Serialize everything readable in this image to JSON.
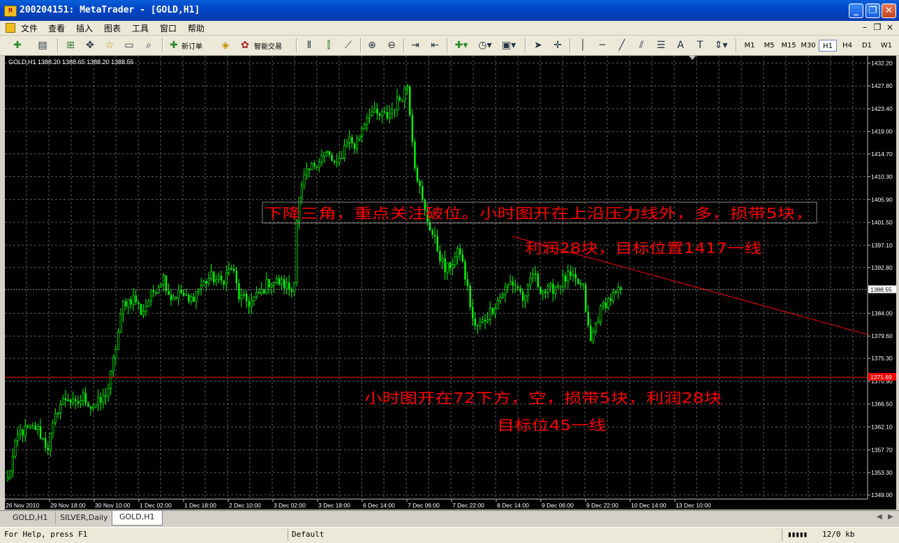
{
  "window": {
    "title": "200204151: MetaTrader - [GOLD,H1]",
    "app_icon": "metatrader-logo-icon",
    "min_glyph": "_",
    "max_glyph": "❐",
    "close_glyph": "✕"
  },
  "menu": {
    "items": [
      "文件",
      "查看",
      "插入",
      "图表",
      "工具",
      "窗口",
      "帮助"
    ],
    "mdi": {
      "min": "–",
      "restore": "❐",
      "close": "×"
    }
  },
  "toolbar": {
    "new_order_label": "新订单",
    "expert_label": "智能交易",
    "timeframes": [
      "M1",
      "M5",
      "M15",
      "M30",
      "H1",
      "H4",
      "D1",
      "W1"
    ],
    "active_timeframe": "H1",
    "text_tool_label": "A"
  },
  "chart": {
    "header": "GOLD,H1  1388.20 1388.65 1388.20 1388.55",
    "annotation_1": "下降三角，重点关注破位。小时图开在上沿压力线外，多，损带5块，",
    "annotation_2": "利润28块，目标位置1417一线",
    "annotation_3": "小时图开在72下方，空，损带5块，利润28块",
    "annotation_4": "目标位45一线",
    "current_price_label": "1388.55",
    "support_price_label": "1371.69"
  },
  "chart_data": {
    "type": "candlestick",
    "symbol": "GOLD",
    "timeframe": "H1",
    "ylim": [
      1348.2,
      1433.6
    ],
    "y_ticks": [
      "1432.20",
      "1427.80",
      "1423.40",
      "1419.00",
      "1414.70",
      "1410.30",
      "1405.90",
      "1401.50",
      "1397.10",
      "1392.80",
      "1388.55",
      "1384.00",
      "1379.60",
      "1375.30",
      "1370.90",
      "1366.50",
      "1362.10",
      "1357.70",
      "1353.30",
      "1349.00"
    ],
    "y_tick_values": [
      1432.2,
      1427.8,
      1423.4,
      1419.0,
      1414.7,
      1410.3,
      1405.9,
      1401.5,
      1397.1,
      1392.8,
      1388.55,
      1384.0,
      1379.6,
      1375.3,
      1370.9,
      1366.5,
      1362.1,
      1357.7,
      1353.3,
      1349.0
    ],
    "x_ticks": [
      "26 Nov 2010",
      "29 Nov 18:00",
      "30 Nov 10:00",
      "1 Dec 02:00",
      "1 Dec 18:00",
      "2 Dec 10:00",
      "3 Dec 02:00",
      "3 Dec 18:00",
      "6 Dec 14:00",
      "7 Dec 06:00",
      "7 Dec 22:00",
      "8 Dec 14:00",
      "9 Dec 06:00",
      "9 Dec 22:00",
      "10 Dec 14:00",
      "13 Dec 10:00"
    ],
    "bars_count": 245,
    "price_anchors": [
      [
        0,
        1352
      ],
      [
        6,
        1361
      ],
      [
        16,
        1362
      ],
      [
        22,
        1358
      ],
      [
        28,
        1366
      ],
      [
        33,
        1368
      ],
      [
        37,
        1366
      ],
      [
        42,
        1368
      ],
      [
        46,
        1366
      ],
      [
        52,
        1367
      ],
      [
        56,
        1370
      ],
      [
        60,
        1378
      ],
      [
        64,
        1386
      ],
      [
        70,
        1387
      ],
      [
        74,
        1384
      ],
      [
        80,
        1388
      ],
      [
        86,
        1391
      ],
      [
        90,
        1387
      ],
      [
        96,
        1388
      ],
      [
        100,
        1386
      ],
      [
        106,
        1389
      ],
      [
        112,
        1391
      ],
      [
        118,
        1390
      ],
      [
        124,
        1393
      ],
      [
        128,
        1387
      ],
      [
        134,
        1386
      ],
      [
        140,
        1388
      ],
      [
        144,
        1390
      ],
      [
        150,
        1390
      ],
      [
        155,
        1389
      ],
      [
        158,
        1388
      ],
      [
        160,
        1404
      ],
      [
        164,
        1410
      ],
      [
        170,
        1413
      ],
      [
        176,
        1415
      ],
      [
        182,
        1412
      ],
      [
        188,
        1418
      ],
      [
        192,
        1416
      ],
      [
        196,
        1420
      ],
      [
        200,
        1423
      ],
      [
        204,
        1422
      ],
      [
        210,
        1422
      ],
      [
        214,
        1424
      ],
      [
        218,
        1426
      ],
      [
        221,
        1428
      ],
      [
        225,
        1413
      ],
      [
        230,
        1404
      ],
      [
        234,
        1400
      ],
      [
        238,
        1396
      ],
      [
        242,
        1392
      ],
      [
        246,
        1394
      ],
      [
        250,
        1396
      ],
      [
        254,
        1389
      ],
      [
        258,
        1381
      ],
      [
        262,
        1382
      ],
      [
        266,
        1384
      ],
      [
        270,
        1386
      ],
      [
        274,
        1388
      ],
      [
        278,
        1390
      ],
      [
        282,
        1389
      ],
      [
        286,
        1386
      ],
      [
        290,
        1392
      ],
      [
        294,
        1389
      ],
      [
        298,
        1388
      ],
      [
        302,
        1389
      ],
      [
        306,
        1390
      ],
      [
        310,
        1391
      ],
      [
        314,
        1390
      ],
      [
        318,
        1389
      ],
      [
        322,
        1378
      ],
      [
        326,
        1383
      ],
      [
        330,
        1386
      ],
      [
        334,
        1387
      ],
      [
        338,
        1388
      ],
      [
        339,
        1388.55
      ]
    ],
    "current_price": 1388.55,
    "support_line": 1371.69,
    "trendline": {
      "from": {
        "x": "8 Dec 06:00",
        "y": 1398.8
      },
      "to": {
        "x": "13 Dec 23:00",
        "y": 1379.9
      }
    }
  },
  "tabs": {
    "items": [
      "GOLD,H1",
      "SILVER,Daily",
      "GOLD,H1"
    ],
    "active_index": 2
  },
  "status": {
    "help": "For Help, press F1",
    "profile": "Default",
    "traffic": "12/0 kb"
  },
  "colors": {
    "bull": "#00ff00",
    "grid": "#5c5c5c",
    "annotation": "#ff0000",
    "support_label_bg": "#ff0000",
    "current_label_bg": "#ffffff"
  }
}
